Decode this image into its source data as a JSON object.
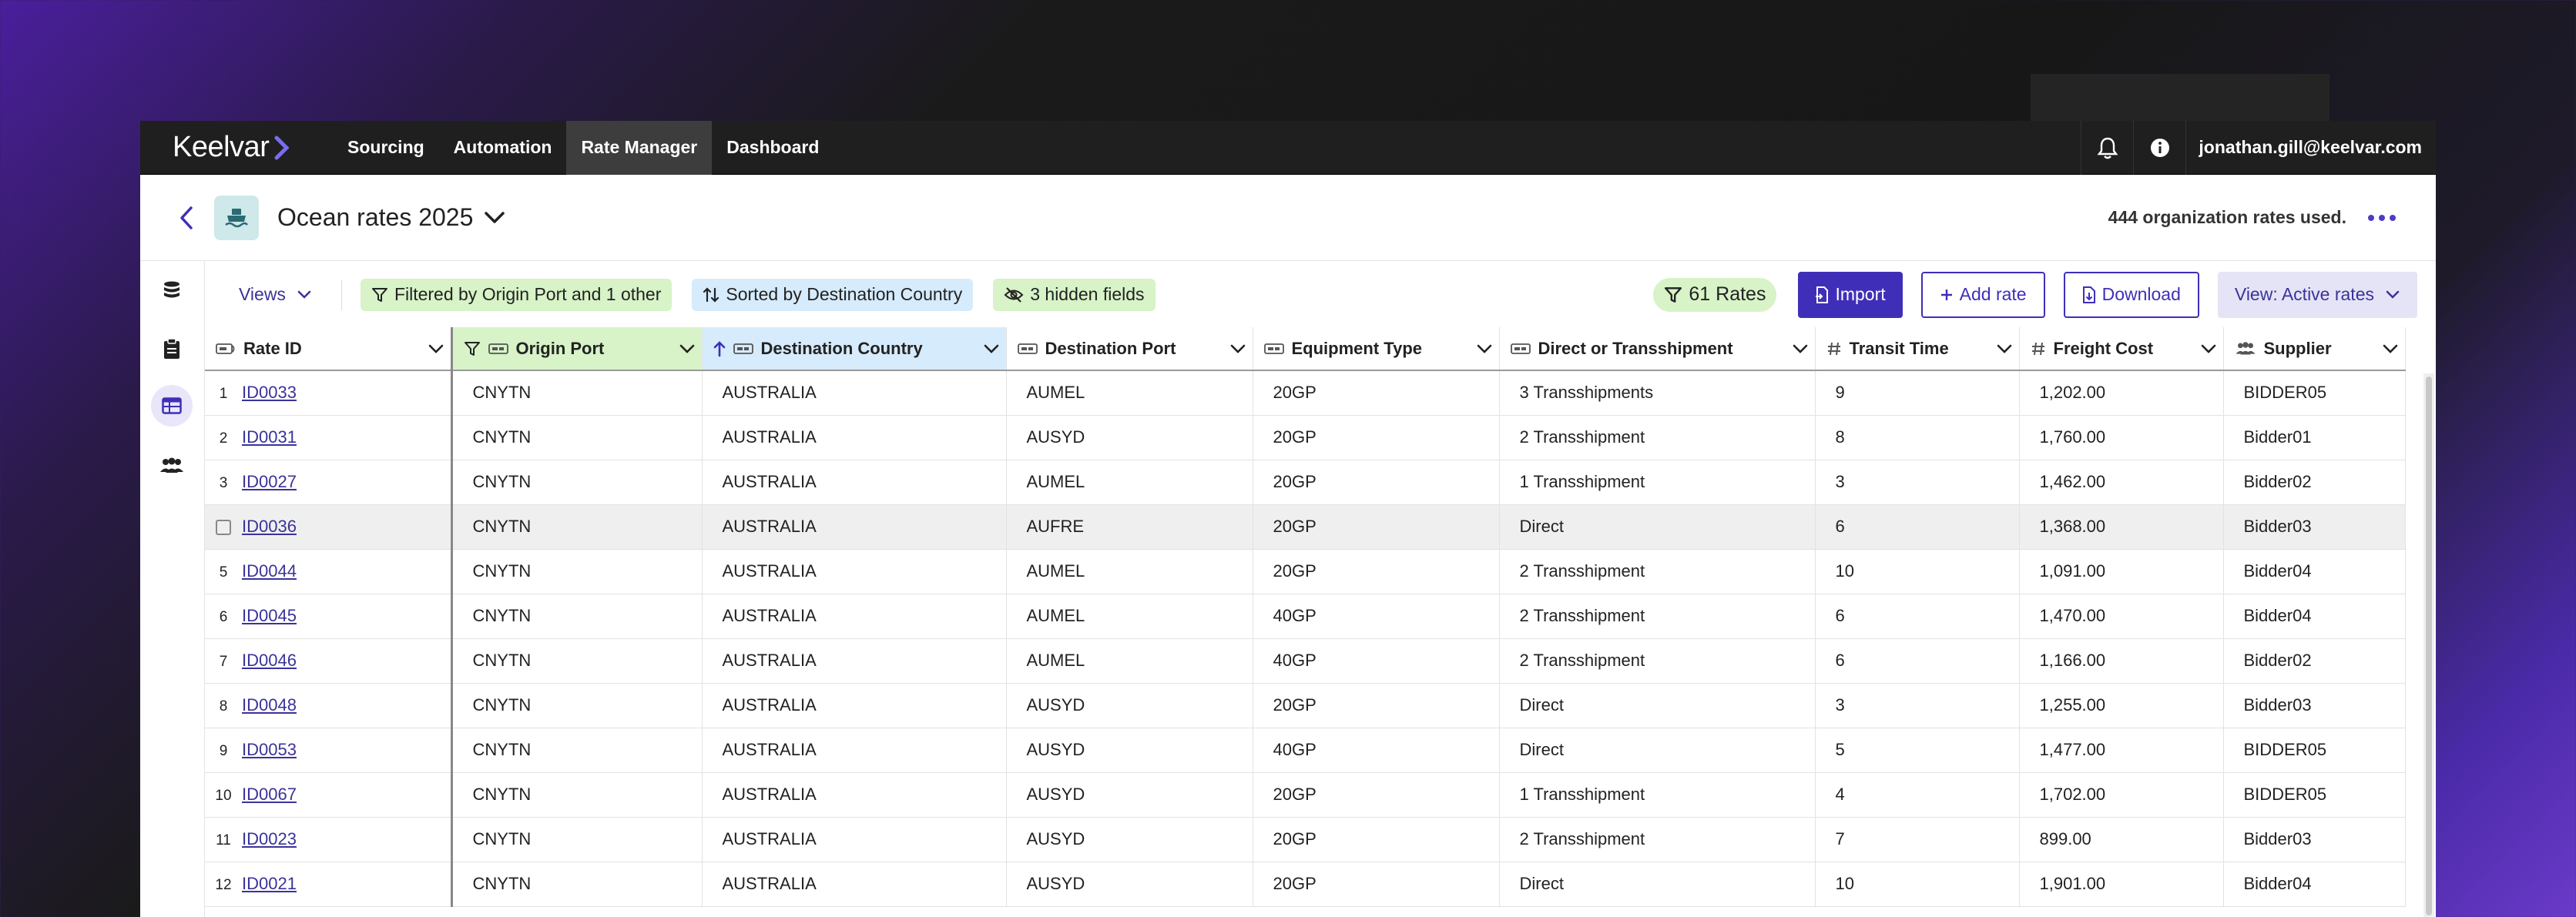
{
  "app": {
    "logo": "Keelvar",
    "nav": [
      "Sourcing",
      "Automation",
      "Rate Manager",
      "Dashboard"
    ],
    "active_nav": "Rate Manager",
    "user": "jonathan.gill@keelvar.com"
  },
  "header": {
    "title": "Ocean rates 2025",
    "usage": "444 organization rates used."
  },
  "toolbar": {
    "views_label": "Views",
    "filter_chip": "Filtered by Origin Port and 1 other",
    "sort_chip": "Sorted by Destination Country",
    "hidden_chip": "3 hidden fields",
    "rates_count": "61 Rates",
    "import_label": "Import",
    "add_rate_label": "Add rate",
    "download_label": "Download",
    "view_label": "View: Active rates"
  },
  "table": {
    "columns": [
      {
        "key": "rate_id",
        "label": "Rate ID",
        "icon": "text-id-icon"
      },
      {
        "key": "origin_port",
        "label": "Origin Port",
        "icon": "text-field-icon",
        "filtered": true
      },
      {
        "key": "destination_country",
        "label": "Destination Country",
        "icon": "text-field-icon",
        "sorted": "asc"
      },
      {
        "key": "destination_port",
        "label": "Destination Port",
        "icon": "text-field-icon"
      },
      {
        "key": "equipment_type",
        "label": "Equipment Type",
        "icon": "text-field-icon"
      },
      {
        "key": "direct_or_transshipment",
        "label": "Direct or Transshipment",
        "icon": "text-field-icon"
      },
      {
        "key": "transit_time",
        "label": "Transit Time",
        "icon": "hash-icon"
      },
      {
        "key": "freight_cost",
        "label": "Freight Cost",
        "icon": "hash-icon"
      },
      {
        "key": "supplier",
        "label": "Supplier",
        "icon": "people-icon"
      }
    ],
    "rows": [
      {
        "n": "1",
        "id": "ID0033",
        "origin": "CNYTN",
        "dcountry": "AUSTRALIA",
        "dport": "AUMEL",
        "equip": "20GP",
        "route": "3 Transshipments",
        "transit": "9",
        "cost": "1,202.00",
        "supplier": "BIDDER05"
      },
      {
        "n": "2",
        "id": "ID0031",
        "origin": "CNYTN",
        "dcountry": "AUSTRALIA",
        "dport": "AUSYD",
        "equip": "20GP",
        "route": "2 Transshipment",
        "transit": "8",
        "cost": "1,760.00",
        "supplier": "Bidder01"
      },
      {
        "n": "3",
        "id": "ID0027",
        "origin": "CNYTN",
        "dcountry": "AUSTRALIA",
        "dport": "AUMEL",
        "equip": "20GP",
        "route": "1 Transshipment",
        "transit": "3",
        "cost": "1,462.00",
        "supplier": "Bidder02"
      },
      {
        "n": "",
        "id": "ID0036",
        "origin": "CNYTN",
        "dcountry": "AUSTRALIA",
        "dport": "AUFRE",
        "equip": "20GP",
        "route": "Direct",
        "transit": "6",
        "cost": "1,368.00",
        "supplier": "Bidder03"
      },
      {
        "n": "5",
        "id": "ID0044",
        "origin": "CNYTN",
        "dcountry": "AUSTRALIA",
        "dport": "AUMEL",
        "equip": "20GP",
        "route": "2 Transshipment",
        "transit": "10",
        "cost": "1,091.00",
        "supplier": "Bidder04"
      },
      {
        "n": "6",
        "id": "ID0045",
        "origin": "CNYTN",
        "dcountry": "AUSTRALIA",
        "dport": "AUMEL",
        "equip": "40GP",
        "route": "2 Transshipment",
        "transit": "6",
        "cost": "1,470.00",
        "supplier": "Bidder04"
      },
      {
        "n": "7",
        "id": "ID0046",
        "origin": "CNYTN",
        "dcountry": "AUSTRALIA",
        "dport": "AUMEL",
        "equip": "40GP",
        "route": "2 Transshipment",
        "transit": "6",
        "cost": "1,166.00",
        "supplier": "Bidder02"
      },
      {
        "n": "8",
        "id": "ID0048",
        "origin": "CNYTN",
        "dcountry": "AUSTRALIA",
        "dport": "AUSYD",
        "equip": "20GP",
        "route": "Direct",
        "transit": "3",
        "cost": "1,255.00",
        "supplier": "Bidder03"
      },
      {
        "n": "9",
        "id": "ID0053",
        "origin": "CNYTN",
        "dcountry": "AUSTRALIA",
        "dport": "AUSYD",
        "equip": "40GP",
        "route": "Direct",
        "transit": "5",
        "cost": "1,477.00",
        "supplier": "BIDDER05"
      },
      {
        "n": "10",
        "id": "ID0067",
        "origin": "CNYTN",
        "dcountry": "AUSTRALIA",
        "dport": "AUSYD",
        "equip": "20GP",
        "route": "1 Transshipment",
        "transit": "4",
        "cost": "1,702.00",
        "supplier": "BIDDER05"
      },
      {
        "n": "11",
        "id": "ID0023",
        "origin": "CNYTN",
        "dcountry": "AUSTRALIA",
        "dport": "AUSYD",
        "equip": "20GP",
        "route": "2 Transshipment",
        "transit": "7",
        "cost": "899.00",
        "supplier": "Bidder03"
      },
      {
        "n": "12",
        "id": "ID0021",
        "origin": "CNYTN",
        "dcountry": "AUSTRALIA",
        "dport": "AUSYD",
        "equip": "20GP",
        "route": "Direct",
        "transit": "10",
        "cost": "1,901.00",
        "supplier": "Bidder04"
      }
    ],
    "hovered_row_index": 3
  },
  "colors": {
    "accent": "#3f2fb8",
    "filter_bg": "#d7f3c7",
    "sort_bg": "#d6ebfb",
    "nav_bg": "#1f1f1f"
  }
}
